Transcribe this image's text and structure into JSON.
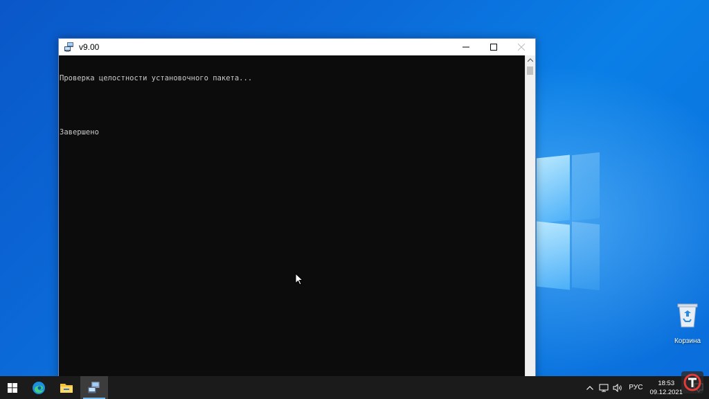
{
  "window": {
    "title": "v9.00",
    "controls": [
      "minimize",
      "maximize",
      "close"
    ]
  },
  "console": {
    "lines": [
      "Проверка целостности установочного пакета...",
      "",
      "Завершено"
    ]
  },
  "desktop": {
    "icons": [
      {
        "label": "Корзина",
        "icon": "recycle-bin-icon"
      }
    ]
  },
  "taskbar": {
    "items": [
      {
        "icon": "start-windows-icon"
      },
      {
        "icon": "edge-browser-icon"
      },
      {
        "icon": "file-explorer-icon"
      },
      {
        "icon": "console-app-icon",
        "active": true
      }
    ],
    "tray": {
      "language": "РУС",
      "time": "18:53",
      "date": "09.12.2021"
    }
  },
  "colors": {
    "accent": "#76b9ed",
    "taskbar": "#1b1b1b",
    "console_bg": "#0c0c0c",
    "console_text": "#cccccc"
  }
}
